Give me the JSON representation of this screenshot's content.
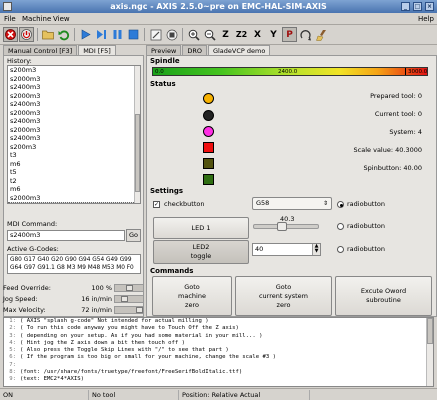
{
  "window": {
    "title": "axis.ngc - AXIS 2.5.0~pre on EMC-HAL-SIM-AXIS"
  },
  "menu": [
    {
      "label": "File",
      "x": 4
    },
    {
      "label": "Machine",
      "x": 22
    },
    {
      "label": "View",
      "x": 53
    }
  ],
  "menu_help": "Help",
  "toolbar": {
    "icons": [
      "estop-icon",
      "machine-power-icon",
      "open-file-icon",
      "reload-icon",
      "run-icon",
      "step-icon",
      "pause-icon",
      "stop-icon",
      "block-delete-icon",
      "optional-stop-icon",
      "zoom-in-icon",
      "zoom-out-icon",
      "view-z-icon",
      "view-z2-icon",
      "view-x-icon",
      "view-y-icon",
      "view-p-icon",
      "rotate-view-icon",
      "clear-plot-icon"
    ],
    "view_labels": {
      "z": "Z",
      "z2": "Z2",
      "x": "X",
      "y": "Y",
      "p": "P"
    }
  },
  "left_tabs": [
    "Manual Control [F3]",
    "MDI [F5]"
  ],
  "mdi": {
    "history_label": "History:",
    "history": [
      "s200m3",
      "s2000m3",
      "s2400m3",
      "s2000m3",
      "s2400m3",
      "s2000m3",
      "s2400m3",
      "s2000m3",
      "s2400m3",
      "s200m3",
      "t3",
      "m6",
      "t5",
      "t2",
      "m6",
      "s2000m3",
      "s2400m3"
    ],
    "selected_index": 16,
    "command_label": "MDI Command:",
    "command_value": "s2400m3",
    "go_label": "Go",
    "active_label": "Active G-Codes:",
    "active_line1": "G80 G17 G40 G20 G90 G94 G54 G49 G99",
    "active_line2": "G64 G97 G91.1 G8 M3 M9 M48 M53 M0 F0"
  },
  "overrides": [
    {
      "name": "Feed Override:",
      "value": "100 %",
      "level": 0.5
    },
    {
      "name": "Jog Speed:",
      "value": "16 in/min",
      "level": 0.3
    },
    {
      "name": "Max Velocity:",
      "value": "72 in/min",
      "level": 1.0
    }
  ],
  "right_tabs": [
    "Preview",
    "DRO",
    "GladeVCP demo"
  ],
  "gladevcp": {
    "spindle_heading": "Spindle",
    "spindle_ticks": [
      "0.0",
      "2400.0",
      "3000.0"
    ],
    "spindle_needle": 0.92,
    "status_heading": "Status",
    "leds": [
      {
        "shape": "circle",
        "color": "#f7b100"
      },
      {
        "shape": "circle",
        "color": "#222222"
      },
      {
        "shape": "circle",
        "color": "#ff2fe4"
      },
      {
        "shape": "square",
        "color": "#ef0f0f"
      },
      {
        "shape": "square",
        "color": "#52520e"
      },
      {
        "shape": "square",
        "color": "#2f6d12"
      }
    ],
    "status_lines": [
      "Prepared tool: 0",
      "Current tool: 0",
      "System: 4",
      "Scale value: 40.3000",
      "Spinbutton: 40.00"
    ],
    "settings_heading": "Settings",
    "checkbutton_label": "checkbutton",
    "checkbutton_checked": true,
    "combo_value": "G58",
    "radios": [
      "radiobutton",
      "radiobutton",
      "radiobutton"
    ],
    "radio_selected": 0,
    "led1_label": "LED 1",
    "led2_label": "LED2\ntoggle",
    "slider_value": "40.3",
    "slider_level": 0.403,
    "spin_value": "40",
    "commands_heading": "Commands",
    "cmd_buttons": [
      "Goto\nmachine\nzero",
      "Goto\ncurrent system\nzero",
      "Excute Oword\nsubroutine"
    ]
  },
  "code_lines": [
    "( AXIS \"splash g-code\" Not intended for actual milling )",
    "( To run this code anyway you might have to Touch Off the Z axis)",
    "( depending on your setup. As if you had some material in your mill... )",
    "( Hint jog the Z axis down a bit then touch off )",
    "( Also press the Toggle Skip Lines with \"/\" to see that part )",
    "( If the program is too big or small for your machine, change the scale #3 )",
    "",
    "(font: /usr/share/fonts/truetype/freefont/FreeSerifBoldItalic.ttf)",
    "(text: EMC2*4*AXIS)"
  ],
  "status": {
    "state": "ON",
    "tool": "No tool",
    "position": "Position: Relative Actual"
  }
}
